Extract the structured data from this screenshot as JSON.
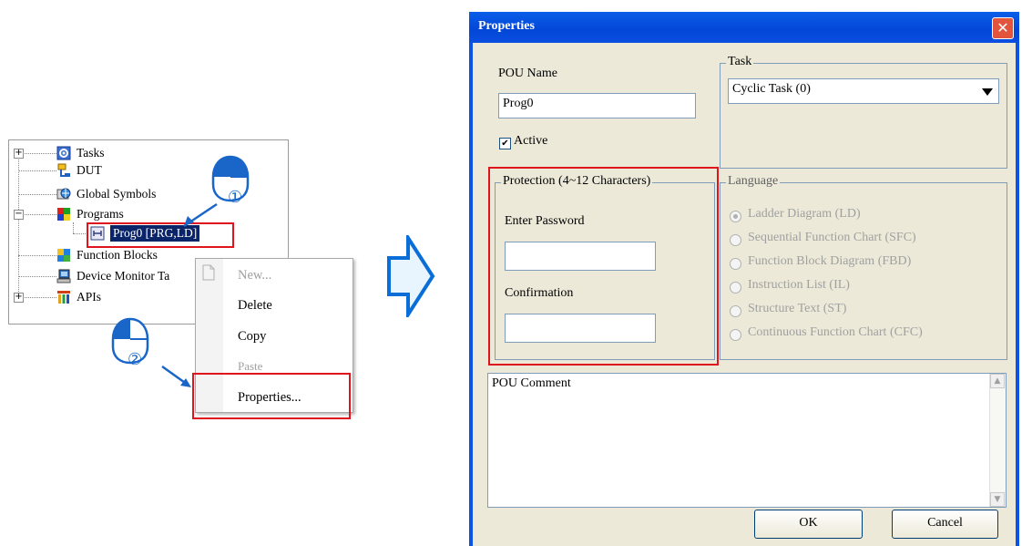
{
  "tree": {
    "items": [
      {
        "label": "Tasks",
        "icon": "tasks-icon"
      },
      {
        "label": "DUT",
        "icon": "dut-icon"
      },
      {
        "label": "Global Symbols",
        "icon": "global-symbols-icon"
      },
      {
        "label": "Programs",
        "icon": "programs-icon"
      },
      {
        "label": "Prog0 [PRG,LD]",
        "icon": "program-icon"
      },
      {
        "label": "Function Blocks",
        "icon": "function-blocks-icon"
      },
      {
        "label": "Device Monitor Ta",
        "icon": "device-monitor-icon"
      },
      {
        "label": "APIs",
        "icon": "apis-icon"
      }
    ],
    "expander_plus": "+",
    "expander_minus": "−"
  },
  "context_menu": {
    "items": [
      {
        "label": "New...",
        "enabled": false
      },
      {
        "label": "Delete",
        "enabled": true
      },
      {
        "label": "Copy",
        "enabled": true
      },
      {
        "label": "Paste",
        "enabled": false
      },
      {
        "label": "Properties...",
        "enabled": true
      }
    ]
  },
  "steps": {
    "step1": "①",
    "step2": "②"
  },
  "dialog": {
    "title": "Properties",
    "close_glyph": "✕",
    "pou_name_label": "POU Name",
    "pou_name_value": "Prog0",
    "active_label": "Active",
    "active_checked": true,
    "task_group_label": "Task",
    "task_value": "Cyclic Task (0)",
    "protection_group_label": "Protection (4~12 Characters)",
    "enter_password_label": "Enter Password",
    "enter_password_value": "",
    "confirmation_label": "Confirmation",
    "confirmation_value": "",
    "language_group_label": "Language",
    "languages": [
      {
        "label": "Ladder Diagram (LD)",
        "selected": true
      },
      {
        "label": "Sequential Function Chart (SFC)",
        "selected": false
      },
      {
        "label": "Function Block Diagram (FBD)",
        "selected": false
      },
      {
        "label": "Instruction List (IL)",
        "selected": false
      },
      {
        "label": "Structure Text (ST)",
        "selected": false
      },
      {
        "label": "Continuous Function Chart (CFC)",
        "selected": false
      }
    ],
    "comment_label": "POU Comment",
    "ok_label": "OK",
    "cancel_label": "Cancel"
  },
  "colors": {
    "highlight": "#e0141c",
    "arrow": "#0a6ed8",
    "selection": "#0a246a",
    "title_bar": "#0346d8"
  }
}
